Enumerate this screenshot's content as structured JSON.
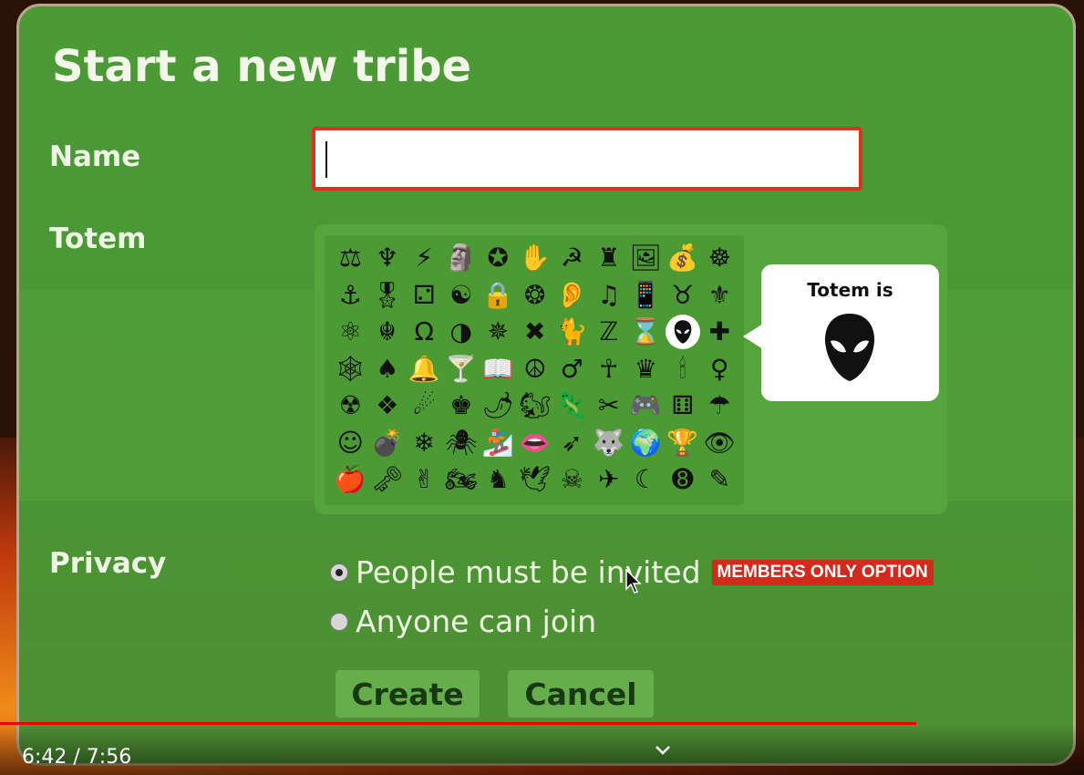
{
  "dialog": {
    "title": "Start a new tribe",
    "name_label": "Name",
    "name_value": "",
    "totem_label": "Totem",
    "privacy_label": "Privacy"
  },
  "totem": {
    "tooltip_label": "Totem is",
    "selected_icon": "alien-icon",
    "rows": [
      [
        "⚖",
        "♆",
        "⚡",
        "🗿",
        "✪",
        "✋",
        "☭",
        "♜",
        "🖼",
        "💰",
        "☸"
      ],
      [
        "⚓",
        "🎖",
        "⚁",
        "☯",
        "🔒",
        "❂",
        "👂",
        "♫",
        "📱",
        "♉",
        "⚜"
      ],
      [
        "⚛",
        "☬",
        "Ω",
        "◑",
        "✵",
        "✖",
        "🐈",
        "ℤ",
        "⌛",
        "👽",
        "✚"
      ],
      [
        "🕸",
        "♠",
        "🔔",
        "🍸",
        "📖",
        "☮",
        "♂",
        "☥",
        "♛",
        "🕯",
        "♀"
      ],
      [
        "☢",
        "❖",
        "☄",
        "♚",
        "🌶",
        "🐿",
        "🦎",
        "✂",
        "🎮",
        "⚅",
        "☂"
      ],
      [
        "☺",
        "💣",
        "❄",
        "🕷",
        "🏂",
        "👄",
        "➶",
        "🐺",
        "🌍",
        "🏆",
        "👁"
      ],
      [
        "🍎",
        "🗝",
        "✌",
        "🏍",
        "♞",
        "🕊",
        "☠",
        "✈",
        "☾",
        "➑",
        "✎"
      ]
    ],
    "names": [
      [
        "scales-icon",
        "trident-icon",
        "lightning-icon",
        "moai-icon",
        "star-circle-icon",
        "hand-icon",
        "hammer-sickle-icon",
        "rook-icon",
        "frame-icon",
        "money-bag-icon",
        "wheel-icon"
      ],
      [
        "anchor-icon",
        "medal-icon",
        "die-icon",
        "yin-yang-icon",
        "lock-icon",
        "flower-icon",
        "ear-icon",
        "music-note-icon",
        "phone-icon",
        "horseshoe-icon",
        "fleur-de-lis-icon"
      ],
      [
        "atom-icon",
        "khanda-icon",
        "omega-icon",
        "half-circle-icon",
        "knot-icon",
        "bones-icon",
        "cat-icon",
        "z-icon",
        "hourglass-icon",
        "alien-icon",
        "cross-icon"
      ],
      [
        "web-icon",
        "spade-icon",
        "bell-icon",
        "cocktail-icon",
        "book-icon",
        "peace-icon",
        "male-icon",
        "ankh-icon",
        "crown-icon",
        "candle-icon",
        "female-icon"
      ],
      [
        "radiation-icon",
        "diamond-cluster-icon",
        "comet-icon",
        "king-icon",
        "pepper-icon",
        "squirrel-icon",
        "lizard-icon",
        "scissors-icon",
        "gamepad-icon",
        "dice-icon",
        "umbrella-icon"
      ],
      [
        "smiley-icon",
        "bomb-icon",
        "snowflake-icon",
        "spider-icon",
        "snowboard-icon",
        "lips-icon",
        "arrow-icon",
        "wolf-icon",
        "globe-icon",
        "trophy-icon",
        "eye-icon"
      ],
      [
        "apple-icon",
        "key-icon",
        "victory-hand-icon",
        "motorcycle-icon",
        "knight-icon",
        "dove-icon",
        "skull-icon",
        "airplane-icon",
        "moon-icon",
        "eight-ball-icon",
        "pencil-icon"
      ]
    ]
  },
  "privacy": {
    "options": [
      {
        "label": "People must be invited",
        "selected": true,
        "badge": "MEMBERS ONLY OPTION"
      },
      {
        "label": "Anyone can join",
        "selected": false
      }
    ]
  },
  "buttons": {
    "create": "Create",
    "cancel": "Cancel"
  },
  "player": {
    "time": "6:42 / 7:56",
    "progress_fraction": 0.845
  },
  "colors": {
    "dialog_green": "#4a9635",
    "badge_red": "#d42a1b",
    "input_border": "#e0301e",
    "button_green": "#66ad4b"
  }
}
